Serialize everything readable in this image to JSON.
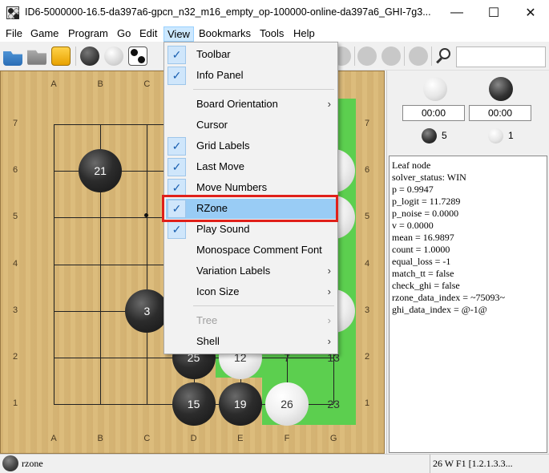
{
  "window": {
    "title": "ID6-5000000-16.5-da397a6-gpcn_n32_m16_empty_op-100000-online-da397a6_GHI-7g3...",
    "minimize": "—",
    "maximize": "☐",
    "close": "✕"
  },
  "menubar": [
    "File",
    "Game",
    "Program",
    "Go",
    "Edit",
    "View",
    "Bookmarks",
    "Tools",
    "Help"
  ],
  "active_menu": "View",
  "view_menu": {
    "items": [
      {
        "label": "Toolbar",
        "checked": true,
        "submenu": false
      },
      {
        "label": "Info Panel",
        "checked": true,
        "submenu": false
      },
      {
        "label": "Board Orientation",
        "checked": false,
        "submenu": true
      },
      {
        "label": "Cursor",
        "checked": false,
        "submenu": false
      },
      {
        "label": "Grid Labels",
        "checked": true,
        "submenu": false
      },
      {
        "label": "Last Move",
        "checked": true,
        "submenu": false
      },
      {
        "label": "Move Numbers",
        "checked": true,
        "submenu": false
      },
      {
        "label": "RZone",
        "checked": true,
        "submenu": false,
        "highlighted": true
      },
      {
        "label": "Play Sound",
        "checked": true,
        "submenu": false
      },
      {
        "label": "Monospace Comment Font",
        "checked": false,
        "submenu": false
      },
      {
        "label": "Variation Labels",
        "checked": false,
        "submenu": true
      },
      {
        "label": "Icon Size",
        "checked": false,
        "submenu": true
      },
      {
        "label": "Tree",
        "checked": false,
        "submenu": true,
        "disabled": true
      },
      {
        "label": "Shell",
        "checked": false,
        "submenu": true
      }
    ],
    "check_glyph": "✓",
    "arrow_glyph": "›"
  },
  "board": {
    "columns": [
      "A",
      "B",
      "C",
      "D",
      "E",
      "F",
      "G"
    ],
    "rows": [
      "7",
      "6",
      "5",
      "4",
      "3",
      "2",
      "1"
    ],
    "stones": [
      {
        "col": "B",
        "row": "6",
        "color": "black",
        "label": "21"
      },
      {
        "col": "C",
        "row": "3",
        "color": "black",
        "label": "3"
      },
      {
        "col": "D",
        "row": "2",
        "color": "black",
        "label": "25"
      },
      {
        "col": "D",
        "row": "1",
        "color": "black",
        "label": "15"
      },
      {
        "col": "E",
        "row": "1",
        "color": "black",
        "label": "19"
      },
      {
        "col": "E",
        "row": "2",
        "color": "white",
        "label": "12"
      },
      {
        "col": "F",
        "row": "1",
        "color": "white",
        "label": "26"
      },
      {
        "col": "G",
        "row": "6",
        "color": "white",
        "label": ""
      },
      {
        "col": "G",
        "row": "5",
        "color": "white",
        "label": ""
      },
      {
        "col": "G",
        "row": "3",
        "color": "white",
        "label": ""
      }
    ],
    "empty_labels": [
      {
        "col": "F",
        "row": "2",
        "label": "7"
      },
      {
        "col": "G",
        "row": "2",
        "label": "13"
      },
      {
        "col": "G",
        "row": "1",
        "label": "23"
      }
    ],
    "board_color": "#d9b878",
    "rzone_color": "#5ccf4f"
  },
  "side_panel": {
    "black_time": "00:00",
    "white_time": "00:00",
    "black_captures": "5",
    "white_captures": "1",
    "info_lines": [
      "Leaf node",
      "solver_status: WIN",
      "p = 0.9947",
      "p_logit = 11.7289",
      "p_noise = 0.0000",
      "v = 0.0000",
      "mean = 16.9897",
      "count = 1.0000",
      "equal_loss = -1",
      "match_tt = false",
      "check_ghi = false",
      "rzone_data_index = ~75093~",
      "ghi_data_index = @-1@"
    ]
  },
  "statusbar": {
    "left_text": "rzone",
    "right_text": "26 W F1 [1.2.1.3.3..."
  },
  "toolbar": {
    "icons": [
      "open-folder-icon",
      "save-icon",
      "new-game-icon",
      "add-black-icon",
      "add-white-icon",
      "setup-icon",
      "nav-first-icon",
      "nav-back-icon",
      "nav-forward-icon",
      "nav-down-icon",
      "nav-up-icon",
      "nav-last-icon",
      "search-icon"
    ]
  }
}
